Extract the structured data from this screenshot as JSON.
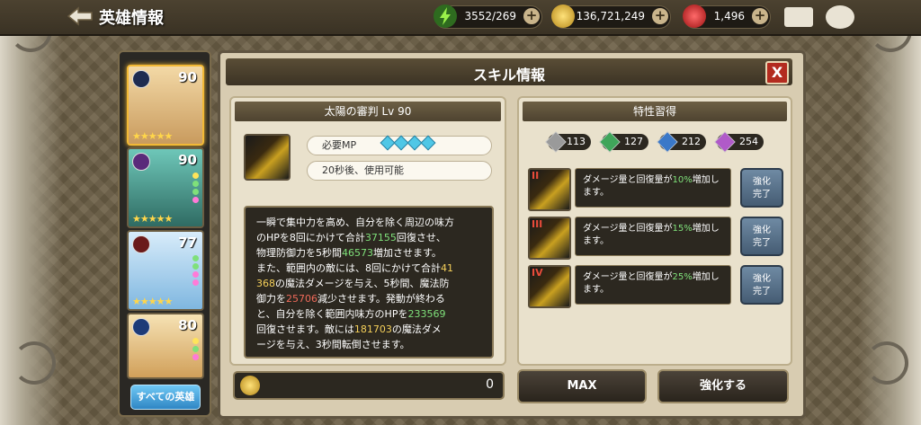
{
  "header": {
    "title": "英雄情報",
    "stamina": "3552/269",
    "gold": "136,721,249",
    "gems": "1,496"
  },
  "heroes": [
    {
      "level": "90",
      "grade": "5",
      "stars": "★★★★★",
      "class_color": "#2a4c8a"
    },
    {
      "level": "90",
      "grade": "5",
      "stars": "★★★★★",
      "class_color": "#6a2a8a"
    },
    {
      "level": "77",
      "grade": "3",
      "stars": "★★★★★",
      "class_color": "#8a2a2a"
    },
    {
      "level": "80",
      "grade": "",
      "stars": "",
      "class_color": "#1d3b78"
    }
  ],
  "all_heroes_label": "すべての英雄",
  "modal": {
    "title": "スキル情報",
    "close": "X"
  },
  "skill": {
    "name": "太陽の審判  Lv 90",
    "mp_label": "必要MP",
    "cooldown": "20秒後、使用可能",
    "desc_lines": [
      [
        "一瞬で集中力を高め、自分を除く周辺の味方"
      ],
      [
        "のHPを8回にかけて合計",
        "37155",
        "回復させ、"
      ],
      [
        "物理防御力を5秒間",
        "46573",
        "増加させます。"
      ],
      [
        "また、範囲内の敵には、8回にかけて合計",
        "41"
      ],
      [
        "368",
        "の魔法ダメージを与え、5秒間、魔法防"
      ],
      [
        "御力を",
        "25706",
        "減少させます。発動が終わる"
      ],
      [
        "と、自分を除く範囲内味方のHPを",
        "233569"
      ],
      [
        "回復させます。敵には",
        "181703",
        "の魔法ダメ"
      ],
      [
        "ージを与え、3秒間転倒させます。"
      ]
    ]
  },
  "traits": {
    "title": "特性習得",
    "materials": [
      {
        "count": "113",
        "color": "#9a9a9a"
      },
      {
        "count": "127",
        "color": "#3fa55a"
      },
      {
        "count": "212",
        "color": "#3a78c8"
      },
      {
        "count": "254",
        "color": "#b05ac8"
      }
    ],
    "rows": [
      {
        "roman": "II",
        "text_a": "ダメージ量と回復量が",
        "pct": "10%",
        "text_b": "増加し",
        "text_c": "ます。",
        "button": "強化\n完了"
      },
      {
        "roman": "III",
        "text_a": "ダメージ量と回復量が",
        "pct": "15%",
        "text_b": "増加し",
        "text_c": "ます。",
        "button": "強化\n完了"
      },
      {
        "roman": "IV",
        "text_a": "ダメージ量と回復量が",
        "pct": "25%",
        "text_b": "増加し",
        "text_c": "ます。",
        "button": "強化\n完了"
      }
    ]
  },
  "footer": {
    "gold_value": "0",
    "max_label": "MAX",
    "enhance_label": "強化する"
  }
}
